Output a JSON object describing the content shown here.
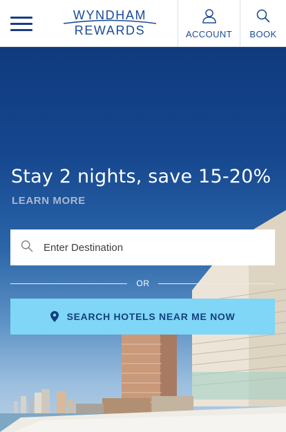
{
  "header": {
    "logo_top": "WYNDHAM",
    "logo_bottom": "REWARDS",
    "account_label": "ACCOUNT",
    "book_label": "BOOK"
  },
  "hero": {
    "promo_title": "Stay 2 nights, save 15-20%",
    "learn_more": "LEARN MORE"
  },
  "search": {
    "placeholder": "Enter Destination",
    "value": ""
  },
  "divider": {
    "text": "OR"
  },
  "near_button": {
    "label": "SEARCH HOTELS NEAR ME NOW"
  },
  "colors": {
    "brand_blue": "#1a4a97",
    "near_button_bg": "#7fd6f6",
    "near_button_text": "#14407f"
  },
  "icons": [
    "menu-icon",
    "user-icon",
    "search-icon",
    "location-pin-icon"
  ]
}
